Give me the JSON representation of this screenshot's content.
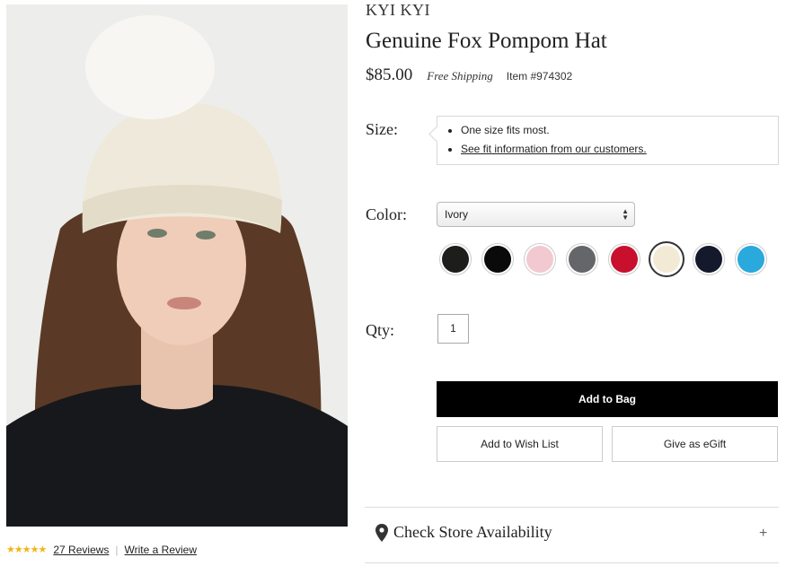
{
  "product": {
    "brand": "KYI KYI",
    "title": "Genuine Fox Pompom Hat",
    "price": "$85.00",
    "shipping": "Free Shipping",
    "item_number": "Item #974302"
  },
  "reviews": {
    "rating": 4.5,
    "count_label": "27 Reviews",
    "write_label": "Write a Review",
    "separator": "|"
  },
  "size": {
    "label": "Size:",
    "notes": [
      "One size fits most.",
      "See fit information from our customers."
    ]
  },
  "color": {
    "label": "Color:",
    "selected": "Ivory",
    "swatches": [
      {
        "name": "black-heather",
        "color": "#1d1d1b"
      },
      {
        "name": "black",
        "color": "#0a0a0a"
      },
      {
        "name": "light-pink",
        "color": "#f2c9d0"
      },
      {
        "name": "grey",
        "color": "#65666a"
      },
      {
        "name": "red",
        "color": "#c8102e"
      },
      {
        "name": "ivory",
        "color": "#f3ead6",
        "selected": true
      },
      {
        "name": "navy",
        "color": "#141a2c"
      },
      {
        "name": "turquoise",
        "color": "#29a9dc"
      }
    ]
  },
  "qty": {
    "label": "Qty:",
    "value": "1"
  },
  "actions": {
    "add_to_bag": "Add to Bag",
    "wish_list": "Add to Wish List",
    "egift": "Give as eGift"
  },
  "store": {
    "label": "Check Store Availability",
    "expand_icon": "plus-icon"
  }
}
